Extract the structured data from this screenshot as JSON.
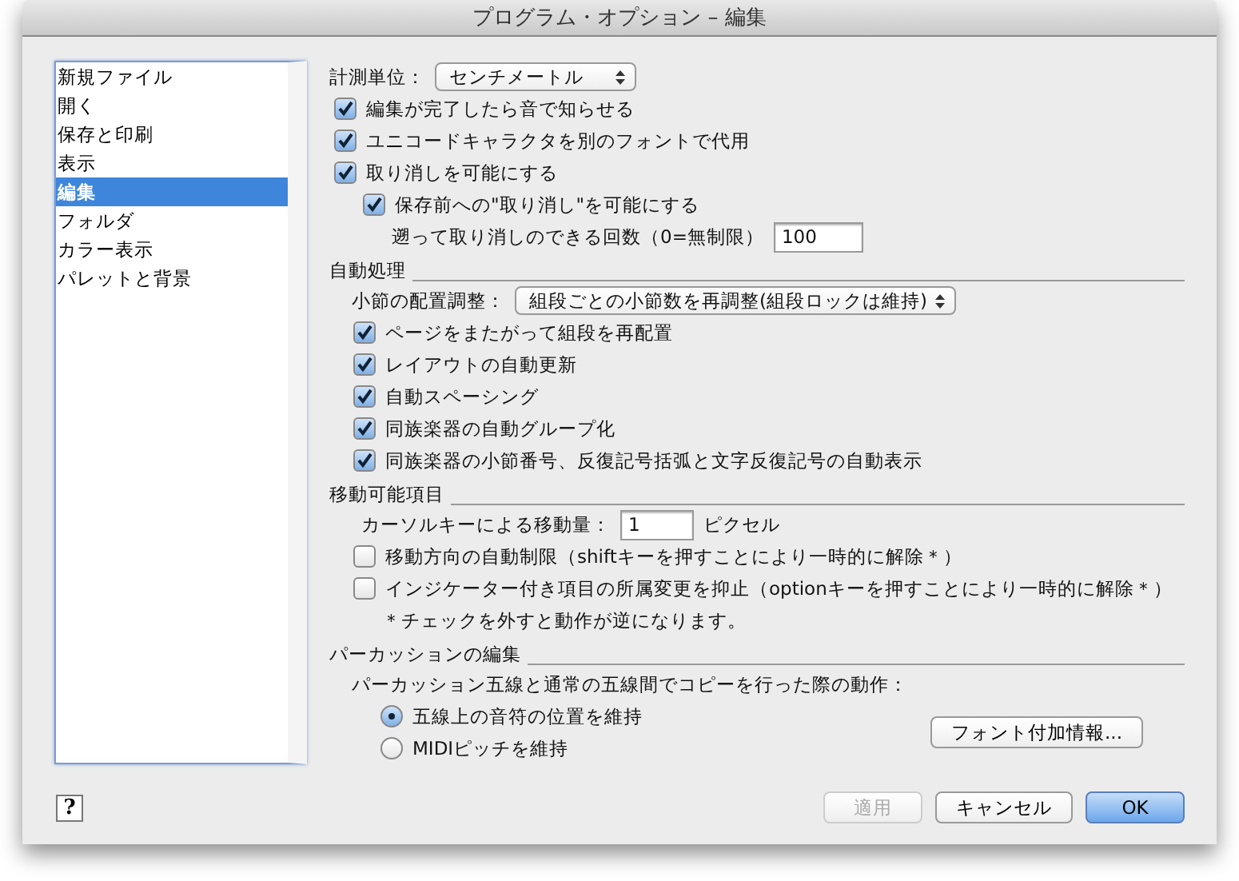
{
  "window": {
    "title": "プログラム・オプション – 編集"
  },
  "sidebar": {
    "items": [
      {
        "label": "新規ファイル",
        "selected": false
      },
      {
        "label": "開く",
        "selected": false
      },
      {
        "label": "保存と印刷",
        "selected": false
      },
      {
        "label": "表示",
        "selected": false
      },
      {
        "label": "編集",
        "selected": true
      },
      {
        "label": "フォルダ",
        "selected": false
      },
      {
        "label": "カラー表示",
        "selected": false
      },
      {
        "label": "パレットと背景",
        "selected": false
      }
    ]
  },
  "general": {
    "unit": {
      "label": "計測単位：",
      "value": "センチメートル"
    },
    "checkboxes": [
      {
        "label": "編集が完了したら音で知らせる",
        "checked": true
      },
      {
        "label": "ユニコードキャラクタを別のフォントで代用",
        "checked": true
      },
      {
        "label": "取り消しを可能にする",
        "checked": true
      }
    ],
    "undo_before_save": {
      "label": "保存前への\"取り消し\"を可能にする",
      "checked": true
    },
    "undo_levels": {
      "label": "遡って取り消しのできる回数（0=無制限）",
      "value": "100"
    }
  },
  "auto": {
    "title": "自動処理",
    "placement": {
      "label": "小節の配置調整：",
      "value": "組段ごとの小節数を再調整(組段ロックは維持)"
    },
    "checkboxes": [
      {
        "label": "ページをまたがって組段を再配置",
        "checked": true
      },
      {
        "label": "レイアウトの自動更新",
        "checked": true
      },
      {
        "label": "自動スペーシング",
        "checked": true
      },
      {
        "label": "同族楽器の自動グループ化",
        "checked": true
      },
      {
        "label": "同族楽器の小節番号、反復記号括弧と文字反復記号の自動表示",
        "checked": true
      }
    ]
  },
  "movable": {
    "title": "移動可能項目",
    "cursor_step": {
      "label": "カーソルキーによる移動量：",
      "value": "1",
      "unit": "ピクセル"
    },
    "checkboxes": [
      {
        "label": "移動方向の自動制限（shiftキーを押すことにより一時的に解除＊）",
        "checked": false
      },
      {
        "label": "インジケーター付き項目の所属変更を抑止（optionキーを押すことにより一時的に解除＊）",
        "checked": false
      }
    ],
    "note": "＊チェックを外すと動作が逆になります。"
  },
  "percussion": {
    "title": "パーカッションの編集",
    "prompt": "パーカッション五線と通常の五線間でコピーを行った際の動作：",
    "radios": [
      {
        "label": "五線上の音符の位置を維持",
        "selected": true
      },
      {
        "label": "MIDIピッチを維持",
        "selected": false
      }
    ],
    "font_button": "フォント付加情報..."
  },
  "help_button": "?",
  "buttons": [
    {
      "label": "適用",
      "disabled": true,
      "default": false
    },
    {
      "label": "キャンセル",
      "disabled": false,
      "default": false
    },
    {
      "label": "OK",
      "disabled": false,
      "default": true
    }
  ]
}
